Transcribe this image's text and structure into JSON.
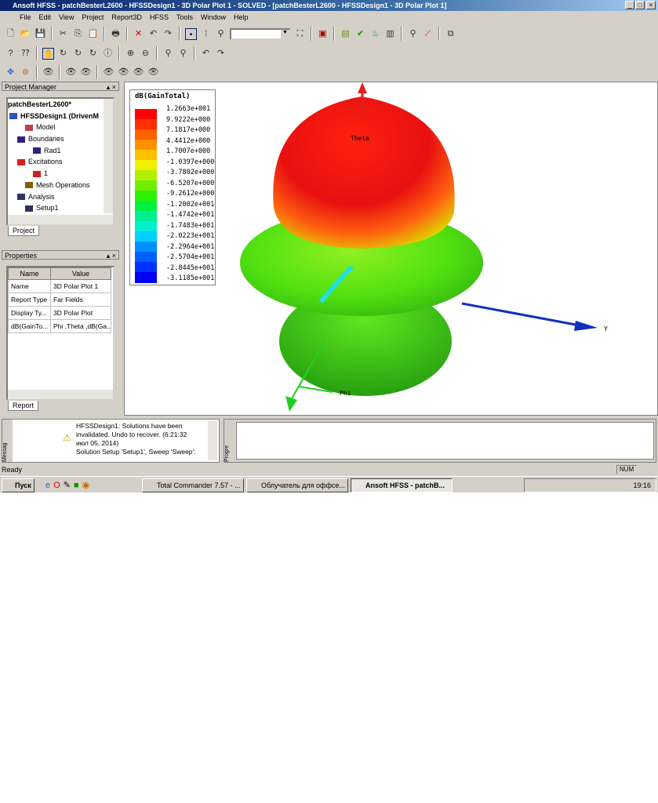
{
  "window": {
    "title": "Ansoft HFSS - patchBesterL2600 - HFSSDesign1 - 3D Polar Plot 1 - SOLVED - [patchBesterL2600 - HFSSDesign1 - 3D Polar Plot 1]"
  },
  "menu": [
    "File",
    "Edit",
    "View",
    "Project",
    "Report3D",
    "HFSS",
    "Tools",
    "Window",
    "Help"
  ],
  "project_manager": {
    "title": "Project Manager",
    "tab": "Project",
    "items": [
      {
        "label": "patchBesterL2600*",
        "indent": 0,
        "color": ""
      },
      {
        "label": "HFSSDesign1 (DrivenM",
        "indent": 0,
        "color": "#3050c0"
      },
      {
        "label": "Model",
        "indent": 2,
        "color": "#c04050"
      },
      {
        "label": "Boundaries",
        "indent": 1,
        "color": "#302080"
      },
      {
        "label": "Rad1",
        "indent": 3,
        "color": "#302080"
      },
      {
        "label": "Excitations",
        "indent": 1,
        "color": "#d02020"
      },
      {
        "label": "1",
        "indent": 3,
        "color": "#d02020"
      },
      {
        "label": "Mesh Operations",
        "indent": 2,
        "color": "#806000"
      },
      {
        "label": "Analysis",
        "indent": 1,
        "color": "#303060"
      },
      {
        "label": "Setup1",
        "indent": 2,
        "color": "#303060"
      }
    ]
  },
  "properties": {
    "title": "Properties",
    "tab": "Report",
    "headers": [
      "Name",
      "Value"
    ],
    "rows": [
      [
        "Name",
        "3D Polar Plot 1"
      ],
      [
        "Report Type",
        "Far Fields"
      ],
      [
        "Display Ty...",
        "3D Polar Plot"
      ],
      [
        "dB(GainTo...",
        "Phi ,Theta ,dB(Ga..."
      ]
    ]
  },
  "legend": {
    "title": "dB(GainTotal)",
    "values": [
      "1.2663e+001",
      "9.9222e+000",
      "7.1817e+000",
      "4.4412e+000",
      "1.7007e+000",
      "-1.0397e+000",
      "-3.7802e+000",
      "-6.5207e+000",
      "-9.2612e+000",
      "-1.2002e+001",
      "-1.4742e+001",
      "-1.7483e+001",
      "-2.0223e+001",
      "-2.2964e+001",
      "-2.5704e+001",
      "-2.8445e+001",
      "-3.1185e+001"
    ],
    "colors": [
      "#ff0000",
      "#ff3000",
      "#ff6000",
      "#ff9000",
      "#ffc000",
      "#f0f000",
      "#b0f000",
      "#70f000",
      "#30f000",
      "#00f040",
      "#00f090",
      "#00f0d0",
      "#00d0ff",
      "#0090ff",
      "#0060ff",
      "#0030ff",
      "#0000ff"
    ]
  },
  "axes": {
    "theta": "Theta",
    "y": "Y",
    "phi": "Phi"
  },
  "messages": {
    "tab": "Messag",
    "lines": [
      "HFSSDesign1: Solutions have been",
      "invalidated. Undo to recover. (6:21:32",
      "июл 05, 2014)",
      "Solution Setup 'Setup1', Sweep 'Sweep':"
    ]
  },
  "progress": {
    "tab": "Progre"
  },
  "status": {
    "text": "Ready",
    "num": "NUM"
  },
  "taskbar": {
    "start": "Пуск",
    "tasks": [
      "Total Commander 7.57 - ...",
      "Облучатель для оффсе...",
      "Ansoft HFSS - patchB..."
    ],
    "clock": "19:16"
  }
}
